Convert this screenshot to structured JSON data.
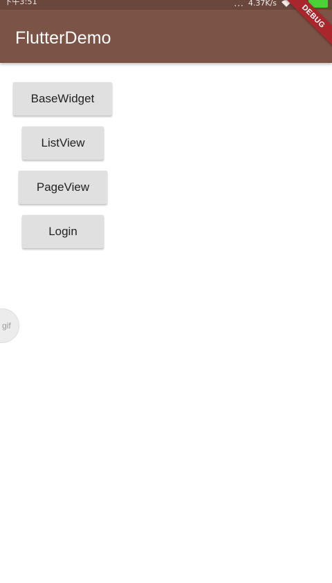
{
  "status_bar": {
    "time": "下午3:51",
    "dots": "...",
    "net_speed": "4.37K/s",
    "sim_label": "x"
  },
  "app_bar": {
    "title": "FlutterDemo",
    "debug_banner": "DEBUG"
  },
  "buttons": [
    {
      "label": "BaseWidget"
    },
    {
      "label": "ListView"
    },
    {
      "label": "PageView"
    },
    {
      "label": "Login"
    }
  ],
  "gif_badge": {
    "label": "gif"
  },
  "colors": {
    "app_bar": "#7b5447",
    "status_bar": "#6a473c",
    "debug_banner": "#a8262c",
    "button_bg": "#e0e0e0"
  }
}
